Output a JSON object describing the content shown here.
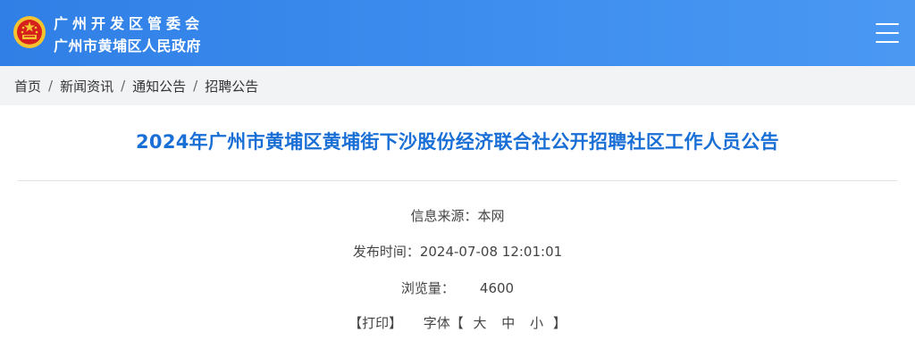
{
  "header": {
    "org_name_line1": "广州开发区管委会",
    "org_name_line2": "广州市黄埔区人民政府",
    "background_color": "#3a8aee",
    "emblem_icon": "national-emblem-icon",
    "menu_icon": "hamburger-menu-icon"
  },
  "breadcrumb": {
    "items": [
      "首页",
      "新闻资讯",
      "通知公告",
      "招聘公告"
    ],
    "separator": "/"
  },
  "article": {
    "title": "2024年广州市黄埔区黄埔街下沙股份经济联合社公开招聘社区工作人员公告",
    "title_color": "#1a6fd6",
    "source_label": "信息来源：",
    "source_value": "本网",
    "publish_label": "发布时间：",
    "publish_value": "2024-07-08 12:01:01",
    "views_label": "浏览量：",
    "views_value": "4600",
    "print_label": "【打印】",
    "font_label": "字体【",
    "font_sizes": [
      "大",
      "中",
      "小"
    ],
    "font_close": "】"
  }
}
